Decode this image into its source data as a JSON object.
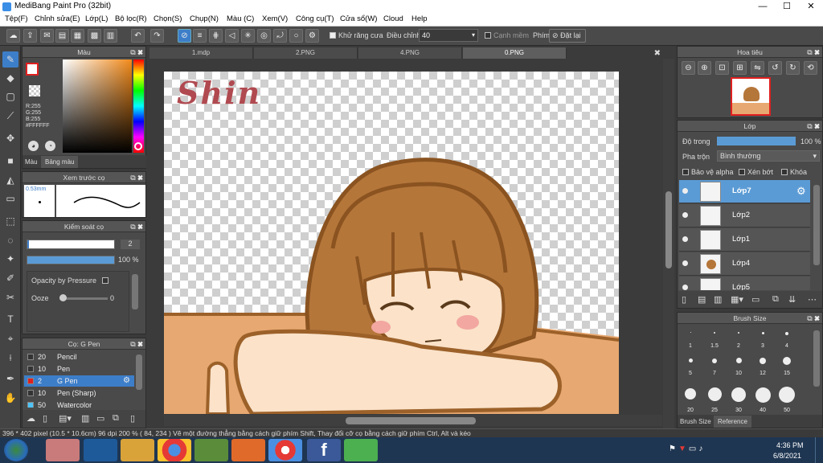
{
  "window": {
    "title": "MediBang Paint Pro (32bit)",
    "min": "—",
    "max": "☐",
    "close": "✕"
  },
  "menu": [
    "Tệp(F)",
    "Chỉnh sửa(E)",
    "Lớp(L)",
    "Bộ lọc(R)",
    "Chọn(S)",
    "Chụp(N)",
    "Màu (C)",
    "Xem(V)",
    "Công cụ(T)",
    "Cửa sổ(W)",
    "Cloud",
    "Help"
  ],
  "toolbar": {
    "antialias_label": "Khử răng cưa",
    "adjust_label": "Điều chỉnh",
    "adjust_value": "40",
    "edge_label": "Cạnh mềm",
    "key_label": "Phím",
    "reset_label": "Đặt lại"
  },
  "color_panel": {
    "title": "Màu",
    "r": "R:255",
    "g": "G:255",
    "b": "B:255",
    "hex": "#FFFFFF",
    "tab_color": "Màu",
    "tab_palette": "Bảng màu"
  },
  "brush_preview": {
    "title": "Xem trước cọ",
    "size": "0.53mm"
  },
  "brush_control": {
    "title": "Kiểm soát cọ",
    "size_value": "2",
    "opacity_value": "100 %",
    "opacity_pressure": "Opacity by Pressure",
    "ooze_label": "Ooze",
    "ooze_value": "0"
  },
  "brush_list": {
    "title": "Cọ: G Pen",
    "items": [
      {
        "size": "20",
        "name": "Pencil",
        "color": "#333333"
      },
      {
        "size": "10",
        "name": "Pen",
        "color": "#333333"
      },
      {
        "size": "2",
        "name": "G Pen",
        "color": "#e02020"
      },
      {
        "size": "10",
        "name": "Pen (Sharp)",
        "color": "#333333"
      },
      {
        "size": "50",
        "name": "Watercolor",
        "color": "#4fc3f7"
      }
    ]
  },
  "tabs": [
    "1.mdp",
    "2.PNG",
    "4.PNG",
    "0.PNG"
  ],
  "canvas": {
    "signature": "Shin"
  },
  "navigator": {
    "title": "Hoa tiêu"
  },
  "layer_panel": {
    "title": "Lớp",
    "opacity_label": "Độ trong",
    "opacity_value": "100 %",
    "blend_label": "Pha trộn",
    "blend_value": "Bình thường",
    "protect_alpha": "Bảo vệ alpha",
    "clipping": "Xén bớt",
    "lock": "Khóa",
    "layers": [
      "Lớp7",
      "Lớp2",
      "Lớp1",
      "Lớp4",
      "Lớp5"
    ]
  },
  "brush_size_panel": {
    "title": "Brush Size",
    "sizes": [
      "1",
      "1.5",
      "2",
      "3",
      "4",
      "5",
      "7",
      "10",
      "12",
      "15",
      "20",
      "25",
      "30",
      "40",
      "50"
    ],
    "tab_size": "Brush Size",
    "tab_reference": "Reference"
  },
  "status": {
    "text": "396 * 402 pixel   (10.5 * 10.6cm)   96 dpi   200 %   ( 84, 234 )   Vẽ một đường thẳng bằng cách giữ phím Shift, Thay đổi cỡ cọ bằng cách giữ phím Ctrl, Alt và kéo"
  },
  "taskbar": {
    "time": "4:36 PM",
    "date": "6/8/2021"
  }
}
